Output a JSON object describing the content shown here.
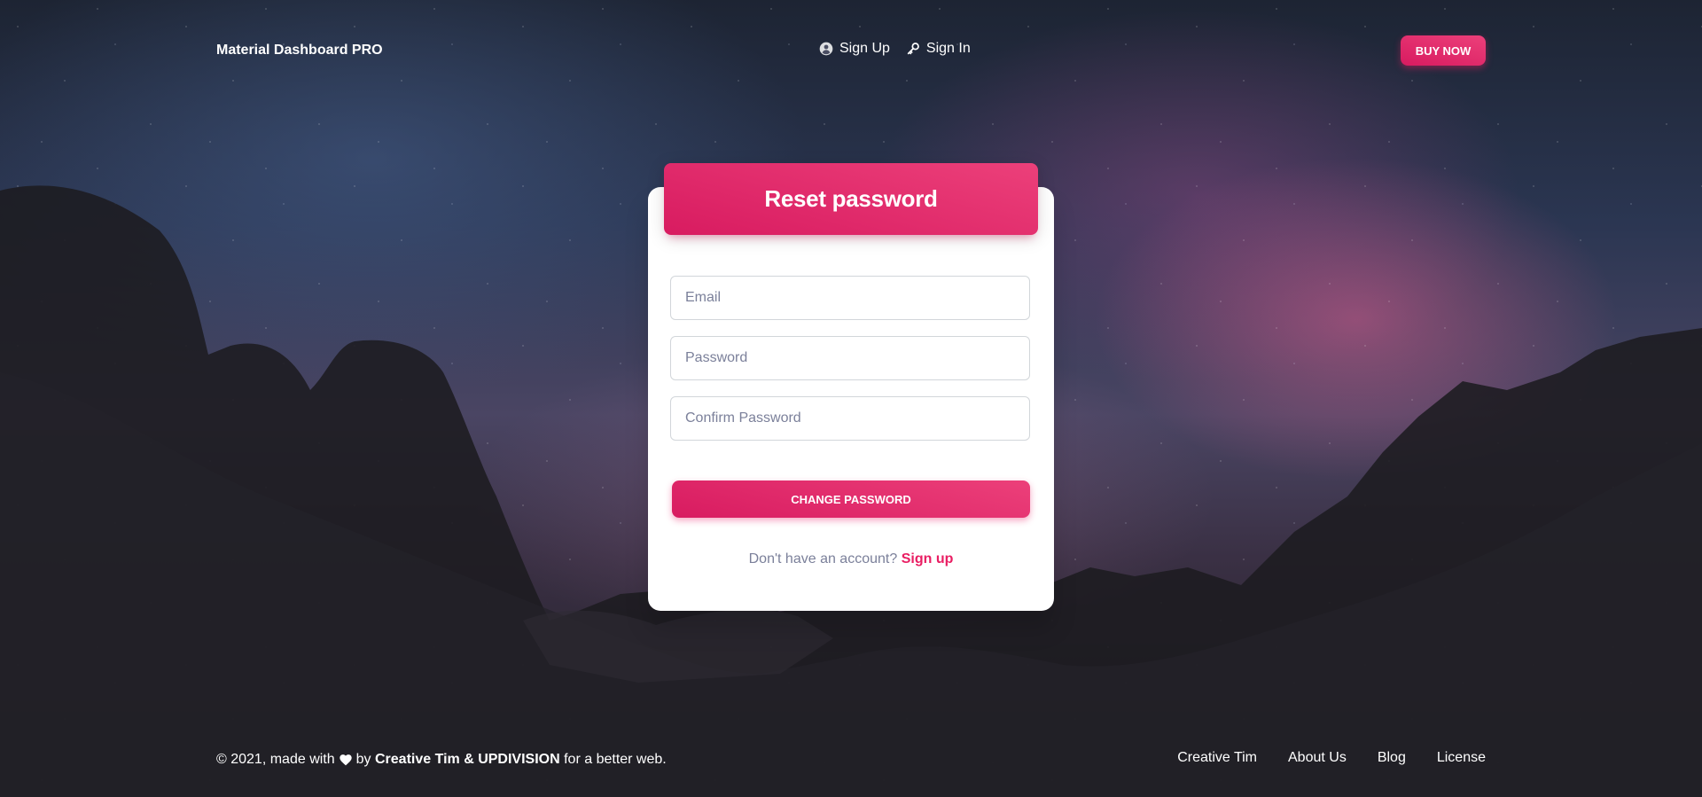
{
  "navbar": {
    "brand": "Material Dashboard PRO",
    "links": [
      {
        "label": "Sign Up",
        "icon": "account-circle-icon"
      },
      {
        "label": "Sign In",
        "icon": "key-icon"
      }
    ],
    "buy_button": "BUY NOW"
  },
  "card": {
    "title": "Reset password",
    "email_placeholder": "Email",
    "password_placeholder": "Password",
    "confirm_placeholder": "Confirm Password",
    "submit_label": "CHANGE PASSWORD",
    "signup_prompt": "Don't have an account?",
    "signup_link": "Sign up"
  },
  "footer": {
    "copyright_prefix": "© 2021, made with",
    "by": "by",
    "authors": "Creative Tim & UPDIVISION",
    "suffix": "for a better web.",
    "links": [
      "Creative Tim",
      "About Us",
      "Blog",
      "License"
    ]
  },
  "colors": {
    "accent": "#e91e63",
    "accent_gradient_start": "#ec407a",
    "accent_gradient_end": "#d81b60",
    "muted_text": "#7b809a"
  }
}
